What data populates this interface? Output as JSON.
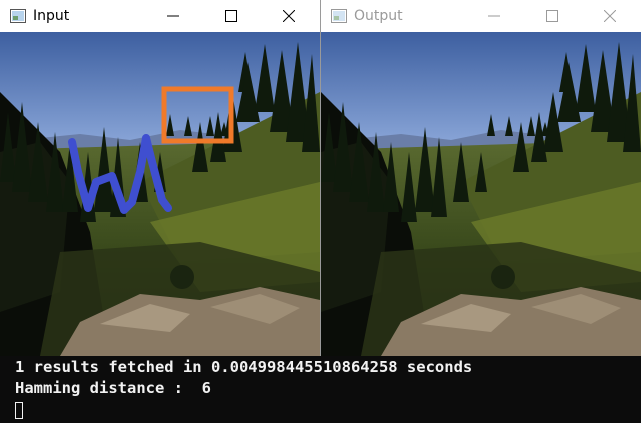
{
  "windows": {
    "input": {
      "title": "Input",
      "state": "active"
    },
    "output": {
      "title": "Output",
      "state": "inactive"
    }
  },
  "input_overlay": {
    "selection_box_color": "#f07a2a",
    "scribble_color": "#3f4fd0"
  },
  "icons": {
    "app": "window-app-icon",
    "minimize": "minimize-icon",
    "maximize": "maximize-icon",
    "close": "close-icon"
  },
  "console": {
    "lines": [
      "1 results fetched in 0.004998445510864258 seconds",
      "Hamming distance :  6"
    ],
    "cursor": "block-cursor"
  }
}
